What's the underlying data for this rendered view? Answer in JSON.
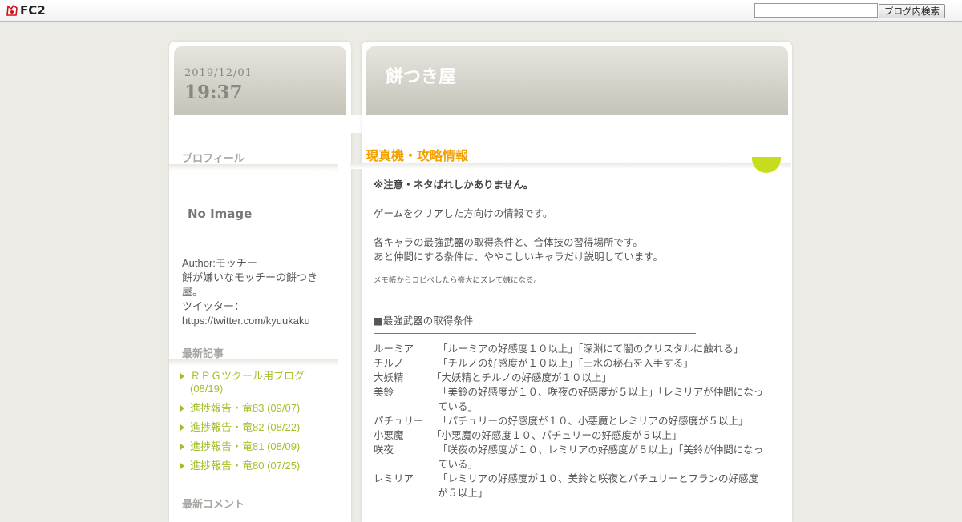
{
  "topbar": {
    "logo_text": "FC2",
    "search_placeholder": "",
    "search_button_label": "ブログ内検索"
  },
  "sidebar": {
    "date": "2019/12/01",
    "time": "19:37",
    "profile_heading": "プロフィール",
    "no_image": "No Image",
    "profile_lines": [
      "Author:モッチー",
      "餅が嫌いなモッチーの餅つき屋。",
      "ツイッター：",
      "https://twitter.com/kyuukaku"
    ],
    "recent_heading": "最新記事",
    "recent_items": [
      "ＲＰＧツクール用ブログ (08/19)",
      "進捗報告・竜83 (09/07)",
      "進捗報告・竜82 (08/22)",
      "進捗報告・竜81 (08/09)",
      "進捗報告・竜80 (07/25)"
    ],
    "comments_heading": "最新コメント"
  },
  "header": {
    "blog_title": "餅つき屋"
  },
  "entry": {
    "title": "現真機・攻略情報",
    "warning": "※注意・ネタばれしかありません。",
    "intro": "ゲームをクリアした方向けの情報です。",
    "desc1": "各キャラの最強武器の取得条件と、合体技の習得場所です。",
    "desc2": "あと仲間にする条件は、ややこしいキャラだけ説明しています。",
    "note": "メモ帳からコピペしたら盛大にズレて嫌になる。",
    "section_heading": "■最強武器の取得条件",
    "characters": [
      {
        "name": "ルーミア",
        "cond": "「ルーミアの好感度１０以上」「深淵にて闇のクリスタルに触れる」"
      },
      {
        "name": "チルノ",
        "cond": "「チルノの好感度が１０以上」「王水の秘石を入手する」"
      },
      {
        "name": "大妖精",
        "cond": "「大妖精とチルノの好感度が１０以上」"
      },
      {
        "name": "美鈴",
        "cond": "「美鈴の好感度が１０、咲夜の好感度が５以上」「レミリアが仲間になっている」"
      },
      {
        "name": "パチュリー",
        "cond": "「パチュリーの好感度が１０、小悪魔とレミリアの好感度が５以上」"
      },
      {
        "name": "小悪魔",
        "cond": "「小悪魔の好感度１０、パチュリーの好感度が５以上」"
      },
      {
        "name": "咲夜",
        "cond": "「咲夜の好感度が１０、レミリアの好感度が５以上」「美鈴が仲間になっている」"
      },
      {
        "name": "レミリア",
        "cond": "「レミリアの好感度が１０、美鈴と咲夜とパチュリーとフランの好感度が５以上」"
      }
    ]
  }
}
